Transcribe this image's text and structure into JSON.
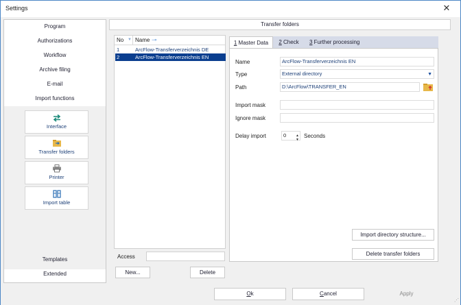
{
  "window": {
    "title": "Settings",
    "close_glyph": "✕"
  },
  "nav": {
    "items": [
      "Program",
      "Authorizations",
      "Workflow",
      "Archive filing",
      "E-mail",
      "Import functions"
    ],
    "sub_items": [
      {
        "label": "Interface",
        "icon": "interface-arrows-icon"
      },
      {
        "label": "Transfer folders",
        "icon": "transfer-folders-icon"
      },
      {
        "label": "Printer",
        "icon": "printer-icon"
      },
      {
        "label": "Import table",
        "icon": "import-table-icon"
      }
    ],
    "bottom_items": [
      "Templates",
      "Extended"
    ]
  },
  "header": {
    "title": "Transfer folders"
  },
  "list": {
    "columns": [
      "No",
      "Name"
    ],
    "rows": [
      {
        "no": "1",
        "name": "ArcFlow-Transferverzeichnis DE"
      },
      {
        "no": "2",
        "name": "ArcFlow-Transferverzeichnis EN",
        "selected": true
      }
    ],
    "access_label": "Access",
    "access_value": "",
    "new_button": "New...",
    "delete_button": "Delete"
  },
  "tabs": [
    {
      "key": "1",
      "rest": " Master Data",
      "active": true
    },
    {
      "key": "2",
      "rest": " Check"
    },
    {
      "key": "3",
      "rest": " Further processing"
    }
  ],
  "form": {
    "name_label": "Name",
    "name_value": "ArcFlow-Transferverzeichnis EN",
    "type_label": "Type",
    "type_value": "External directory",
    "path_label": "Path",
    "path_value": "D:\\ArcFlow\\TRANSFER_EN",
    "import_mask_label": "Import mask",
    "import_mask_value": "",
    "ignore_mask_label": "Ignore mask",
    "ignore_mask_value": "",
    "delay_label": "Delay import",
    "delay_value": "0",
    "delay_unit": "Seconds",
    "import_dir_button": "Import directory structure...",
    "delete_folders_button": "Delete transfer folders"
  },
  "footer": {
    "ok_key": "O",
    "ok_rest": "k",
    "cancel_key": "C",
    "cancel_rest": "ancel",
    "apply": "Apply"
  },
  "colors": {
    "selection": "#0a3e8f",
    "link_text": "#1c3f77",
    "tab_inactive": "#d6dbe8",
    "window_border": "#4a86c5"
  }
}
